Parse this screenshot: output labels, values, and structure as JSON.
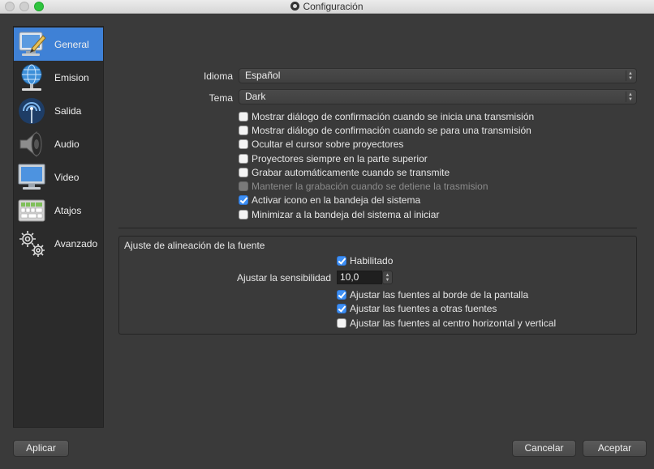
{
  "window": {
    "title": "Configuración"
  },
  "sidebar": {
    "items": [
      {
        "label": "General",
        "icon": "monitor-pencil-icon",
        "active": true
      },
      {
        "label": "Emision",
        "icon": "globe-network-icon",
        "active": false
      },
      {
        "label": "Salida",
        "icon": "broadcast-signal-icon",
        "active": false
      },
      {
        "label": "Audio",
        "icon": "speaker-icon",
        "active": false
      },
      {
        "label": "Video",
        "icon": "monitor-icon",
        "active": false
      },
      {
        "label": "Atajos",
        "icon": "keyboard-icon",
        "active": false
      },
      {
        "label": "Avanzado",
        "icon": "gears-icon",
        "active": false
      }
    ]
  },
  "general": {
    "language_label": "Idioma",
    "language_value": "Español",
    "theme_label": "Tema",
    "theme_value": "Dark",
    "checkboxes": [
      {
        "label": "Mostrar diálogo de confirmación cuando se inicia una transmisión",
        "checked": false,
        "disabled": false
      },
      {
        "label": "Mostrar diálogo de confirmación cuando se para una transmisión",
        "checked": false,
        "disabled": false
      },
      {
        "label": "Ocultar el cursor sobre proyectores",
        "checked": false,
        "disabled": false
      },
      {
        "label": "Proyectores siempre en la parte superior",
        "checked": false,
        "disabled": false
      },
      {
        "label": "Grabar automáticamente cuando se transmite",
        "checked": false,
        "disabled": false
      },
      {
        "label": "Mantener la grabación cuando se detiene la trasmision",
        "checked": false,
        "disabled": true
      },
      {
        "label": "Activar icono en la bandeja del sistema",
        "checked": true,
        "disabled": false
      },
      {
        "label": "Minimizar a la bandeja del sistema al iniciar",
        "checked": false,
        "disabled": false
      }
    ]
  },
  "snapping": {
    "group_title": "Ajuste de alineación de la fuente",
    "enabled_label": "Habilitado",
    "enabled_checked": true,
    "sensitivity_label": "Ajustar la sensibilidad",
    "sensitivity_value": "10,0",
    "options": [
      {
        "label": "Ajustar las fuentes al borde de la pantalla",
        "checked": true
      },
      {
        "label": "Ajustar las fuentes a otras fuentes",
        "checked": true
      },
      {
        "label": "Ajustar las fuentes al centro horizontal y vertical",
        "checked": false
      }
    ]
  },
  "buttons": {
    "apply": "Aplicar",
    "cancel": "Cancelar",
    "accept": "Aceptar"
  },
  "colors": {
    "accent": "#3f81d6",
    "background": "#3a3a3a",
    "sidebar": "#2b2b2b"
  }
}
